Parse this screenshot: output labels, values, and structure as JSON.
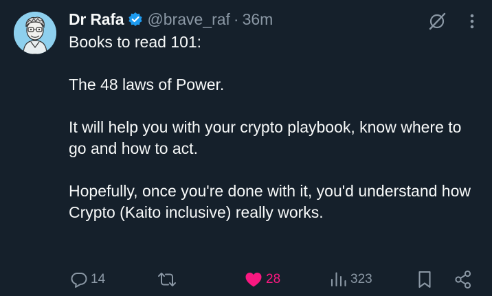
{
  "tweet": {
    "author": {
      "display_name": "Dr Rafa",
      "handle": "@brave_raf",
      "separator": "·",
      "time_ago": "36m",
      "verified": true
    },
    "body": {
      "line1": "Books to read 101:",
      "line2": "The 48 laws of Power.",
      "line3": "It will help you with your crypto playbook, know where to go and how to act.",
      "line4": "Hopefully, once you're done with it, you'd understand how Crypto (Kaito inclusive) really works."
    },
    "actions": {
      "replies": "14",
      "reposts": "",
      "likes": "28",
      "views": "323"
    },
    "icons": {
      "avatar": "cartoon-avatar",
      "verified": "verified-badge-icon",
      "grok": "grok-icon",
      "more": "more-vertical-icon",
      "reply": "reply-icon",
      "repost": "repost-icon",
      "like": "heart-icon",
      "views": "views-icon",
      "bookmark": "bookmark-icon",
      "share": "share-icon"
    },
    "colors": {
      "background": "#15202b",
      "text": "#f7f9f9",
      "secondary": "#8b98a5",
      "verified": "#1d9bf0",
      "like": "#f91880"
    }
  }
}
